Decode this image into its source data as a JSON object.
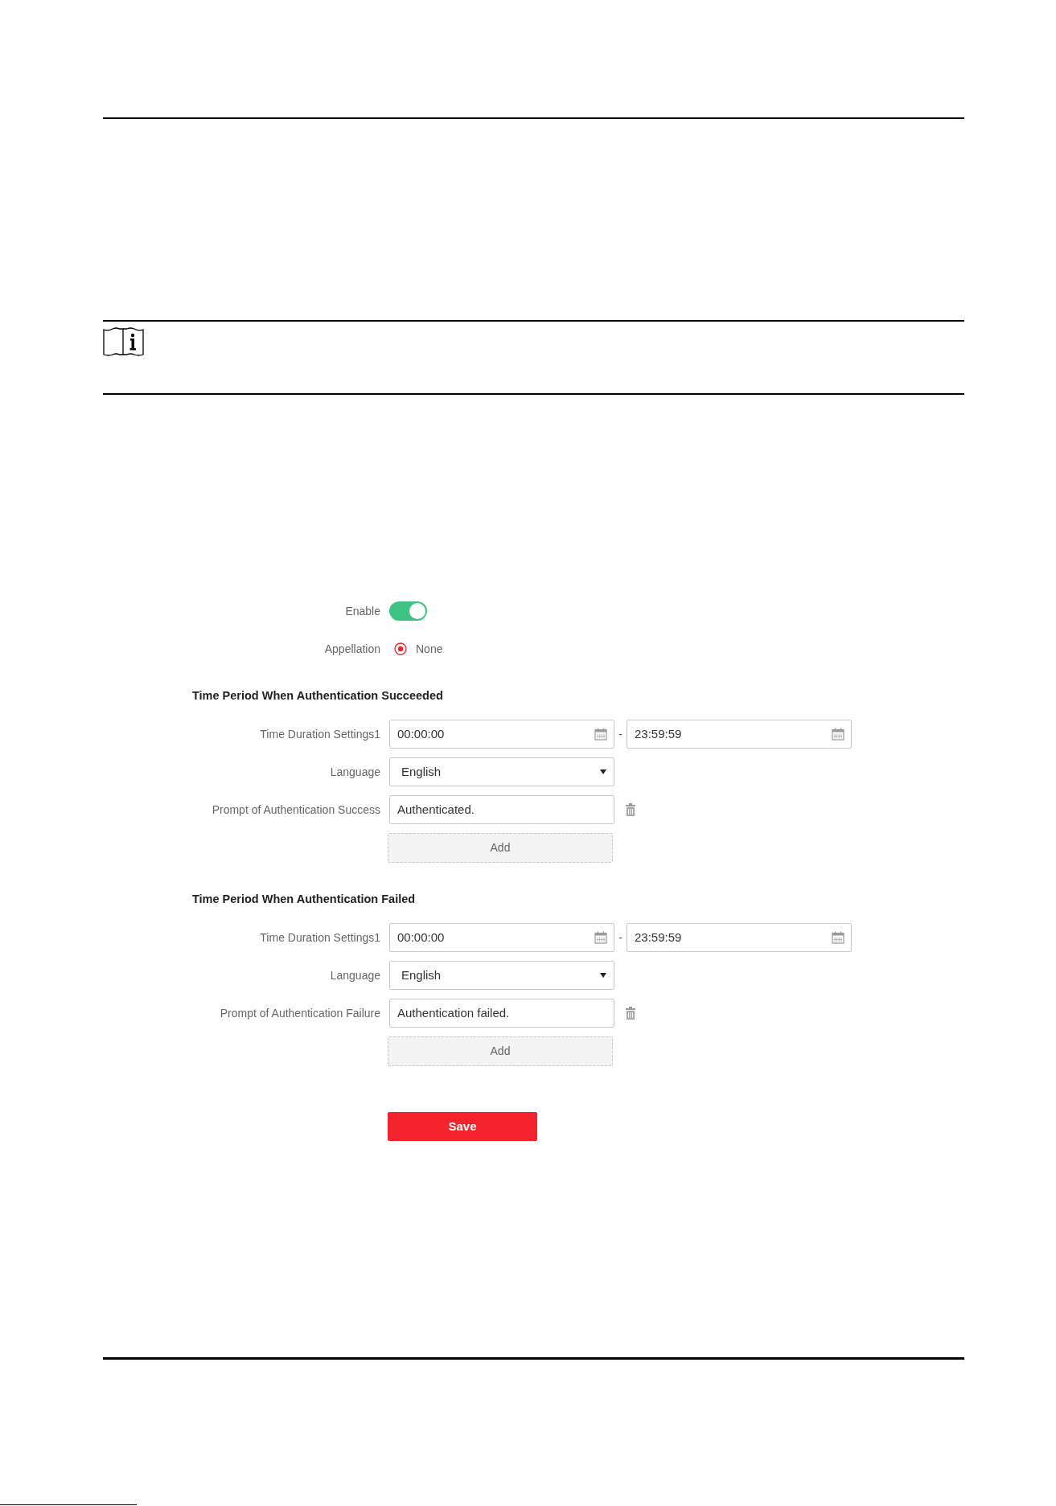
{
  "form": {
    "enable": {
      "label": "Enable",
      "on": true
    },
    "appellation": {
      "label": "Appellation",
      "options": [
        {
          "label": "None",
          "selected": true
        }
      ]
    },
    "sections": [
      {
        "title": "Time Period When Authentication Succeeded",
        "time_duration": {
          "label": "Time Duration Settings1",
          "start": "00:00:00",
          "separator": "-",
          "end": "23:59:59"
        },
        "language": {
          "label": "Language",
          "value": "English"
        },
        "prompt": {
          "label": "Prompt of Authentication Success",
          "value": "Authenticated."
        },
        "add_button": "Add"
      },
      {
        "title": "Time Period When Authentication Failed",
        "time_duration": {
          "label": "Time Duration Settings1",
          "start": "00:00:00",
          "separator": "-",
          "end": "23:59:59"
        },
        "language": {
          "label": "Language",
          "value": "English"
        },
        "prompt": {
          "label": "Prompt of Authentication Failure",
          "value": "Authentication failed."
        },
        "add_button": "Add"
      }
    ],
    "save_button": "Save"
  }
}
